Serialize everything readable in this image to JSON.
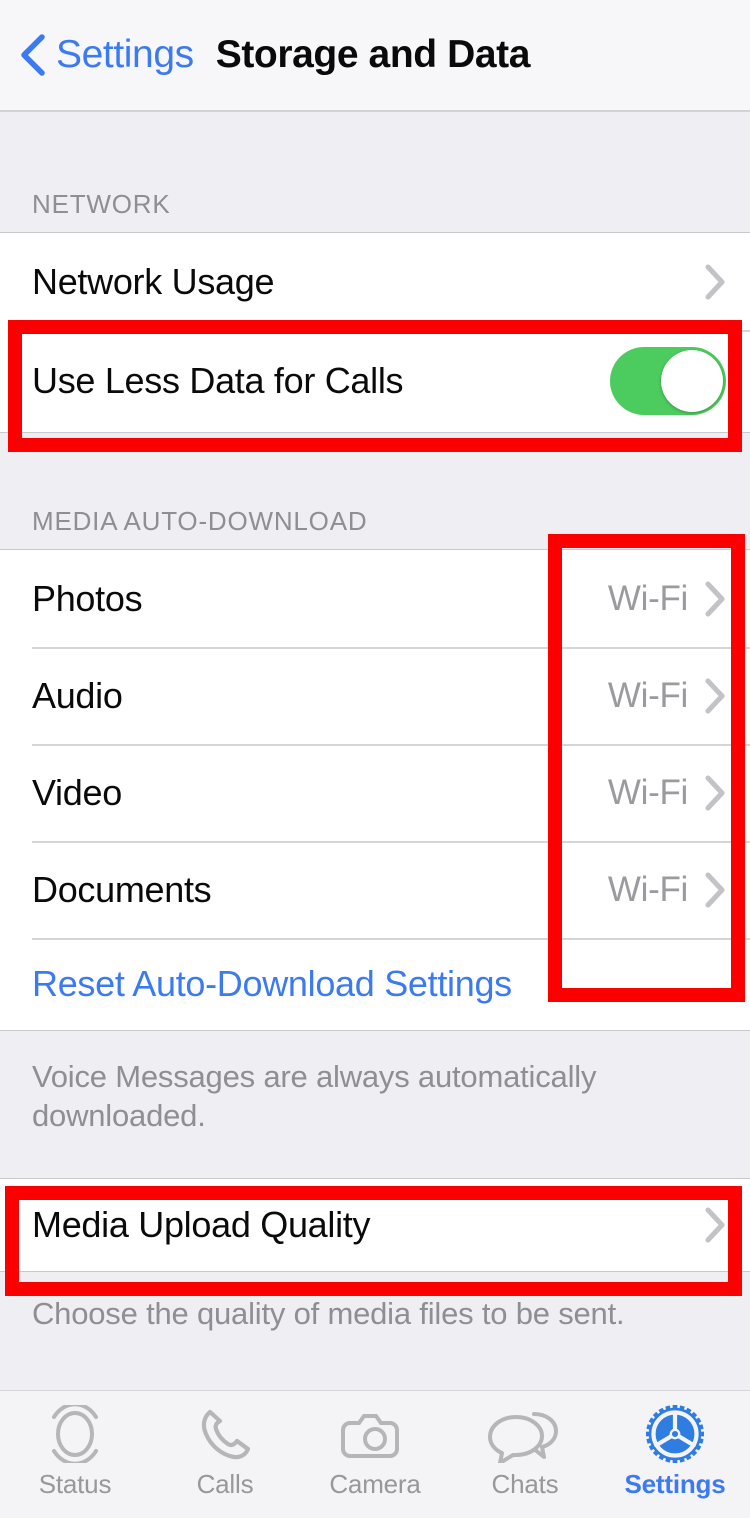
{
  "nav": {
    "back_label": "Settings",
    "title": "Storage and Data",
    "back_icon": "chevron-left-icon",
    "accent": "#3b7af0"
  },
  "network_section": {
    "header": "NETWORK",
    "rows": [
      {
        "label": "Network Usage",
        "type": "disclosure",
        "icon": "chevron-right-icon"
      },
      {
        "label": "Use Less Data for Calls",
        "type": "toggle",
        "toggle_on": true,
        "toggle_color": "#4ccc5e"
      }
    ]
  },
  "media_section": {
    "header": "MEDIA AUTO-DOWNLOAD",
    "rows": [
      {
        "label": "Photos",
        "value": "Wi-Fi",
        "icon": "chevron-right-icon"
      },
      {
        "label": "Audio",
        "value": "Wi-Fi",
        "icon": "chevron-right-icon"
      },
      {
        "label": "Video",
        "value": "Wi-Fi",
        "icon": "chevron-right-icon"
      },
      {
        "label": "Documents",
        "value": "Wi-Fi",
        "icon": "chevron-right-icon"
      }
    ],
    "reset_label": "Reset Auto-Download Settings",
    "note": "Voice Messages are always automatically downloaded."
  },
  "upload_section": {
    "row_label": "Media Upload Quality",
    "row_icon": "chevron-right-icon",
    "note": "Choose the quality of media files to be sent."
  },
  "tabbar": {
    "items": [
      {
        "label": "Status",
        "icon": "status-rings-icon",
        "active": false
      },
      {
        "label": "Calls",
        "icon": "phone-icon",
        "active": false
      },
      {
        "label": "Camera",
        "icon": "camera-icon",
        "active": false
      },
      {
        "label": "Chats",
        "icon": "chat-bubbles-icon",
        "active": false
      },
      {
        "label": "Settings",
        "icon": "gear-icon",
        "active": true
      }
    ]
  },
  "annotations": {
    "color": "#fb0000",
    "boxes": [
      {
        "name": "highlight-use-less-data-row"
      },
      {
        "name": "highlight-wifi-value-column"
      },
      {
        "name": "highlight-media-upload-quality-row"
      }
    ]
  }
}
